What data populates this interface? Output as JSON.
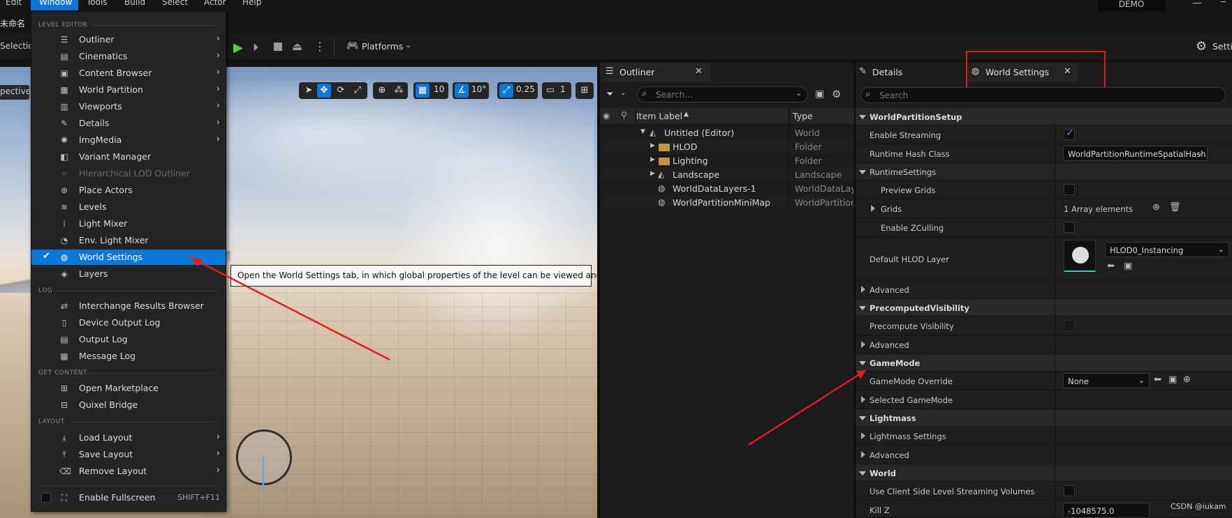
{
  "menubar": {
    "items": [
      "Edit",
      "Window",
      "Tools",
      "Build",
      "Select",
      "Actor",
      "Help"
    ],
    "active": "Window",
    "project_badge": "DEMO"
  },
  "project": {
    "name": "未命名"
  },
  "toolbar": {
    "selection_mode": "Selectio",
    "platforms_label": "Platforms"
  },
  "viewport": {
    "perspective_label": "pective",
    "grid_snap": "10",
    "rotation_snap": "10°",
    "scale_snap": "0.25",
    "camera_speed": "1"
  },
  "window_menu": {
    "sections": {
      "level_editor": "LEVEL EDITOR",
      "log": "LOG",
      "get_content": "GET CONTENT",
      "layout": "LAYOUT"
    },
    "items": [
      {
        "label": "Outliner",
        "icon": "list-icon"
      },
      {
        "label": "Cinematics",
        "icon": "film-icon"
      },
      {
        "label": "Content Browser",
        "icon": "folder-icon"
      },
      {
        "label": "World Partition",
        "icon": "grid-icon"
      },
      {
        "label": "Viewports",
        "icon": "viewport-icon"
      },
      {
        "label": "Details",
        "icon": "details-icon"
      },
      {
        "label": "ImgMedia",
        "icon": "media-icon"
      },
      {
        "label": "Variant Manager",
        "icon": "variant-icon"
      },
      {
        "label": "Hierarchical LOD Outliner",
        "icon": "lod-icon"
      },
      {
        "label": "Place Actors",
        "icon": "place-icon"
      },
      {
        "label": "Levels",
        "icon": "levels-icon"
      },
      {
        "label": "Light Mixer",
        "icon": "light-icon"
      },
      {
        "label": "Env. Light Mixer",
        "icon": "env-light-icon"
      },
      {
        "label": "World Settings",
        "icon": "globe-icon"
      },
      {
        "label": "Layers",
        "icon": "layers-icon"
      },
      {
        "label": "Interchange Results Browser",
        "icon": "interchange-icon"
      },
      {
        "label": "Device Output Log",
        "icon": "device-log-icon"
      },
      {
        "label": "Output Log",
        "icon": "log-icon"
      },
      {
        "label": "Message Log",
        "icon": "message-log-icon"
      },
      {
        "label": "Open Marketplace",
        "icon": "marketplace-icon"
      },
      {
        "label": "Quixel Bridge",
        "icon": "bridge-icon"
      },
      {
        "label": "Load Layout",
        "icon": "load-layout-icon"
      },
      {
        "label": "Save Layout",
        "icon": "save-layout-icon"
      },
      {
        "label": "Remove Layout",
        "icon": "remove-layout-icon"
      },
      {
        "label": "Enable Fullscreen",
        "icon": "fullscreen-icon",
        "shortcut": "SHIFT+F11"
      }
    ]
  },
  "tooltip": {
    "text": "Open the World Settings tab, in which global properties of the level can be viewed and edited."
  },
  "outliner": {
    "tab_label": "Outliner",
    "search_placeholder": "Search...",
    "col_label": "Item Label",
    "col_type": "Type",
    "rows": [
      {
        "label": "Untitled (Editor)",
        "type": "World"
      },
      {
        "label": "HLOD",
        "type": "Folder"
      },
      {
        "label": "Lighting",
        "type": "Folder"
      },
      {
        "label": "Landscape",
        "type": "Landscape"
      },
      {
        "label": "WorldDataLayers-1",
        "type": "WorldDataLay"
      },
      {
        "label": "WorldPartitionMiniMap",
        "type": "WorldPartition"
      }
    ]
  },
  "details": {
    "details_tab": "Details",
    "world_settings_tab": "World Settings",
    "search_placeholder": "Search",
    "categories": {
      "wp_setup": "WorldPartitionSetup",
      "runtime": "RuntimeSettings",
      "advanced1": "Advanced",
      "precomputed": "PrecomputedVisibility",
      "advanced2": "Advanced",
      "gamemode": "GameMode",
      "lightmass": "Lightmass",
      "advanced3": "Advanced",
      "world": "World"
    },
    "props": {
      "enable_streaming": "Enable Streaming",
      "runtime_hash_class": "Runtime Hash Class",
      "runtime_hash_value": "WorldPartitionRuntimeSpatialHash",
      "preview_grids": "Preview Grids",
      "grids": "Grids",
      "grids_value": "1 Array elements",
      "enable_zculling": "Enable ZCulling",
      "default_hlod_layer": "Default HLOD Layer",
      "hlod_value": "HLOD0_Instancing",
      "precompute_visibility": "Precompute Visibility",
      "gamemode_override": "GameMode Override",
      "gamemode_value": "None",
      "selected_gamemode": "Selected GameMode",
      "lightmass_settings": "Lightmass Settings",
      "use_client_side": "Use Client Side Level Streaming Volumes",
      "kill_z": "Kill Z",
      "kill_z_value": "-1048575.0"
    }
  },
  "watermark": "CSDN @iukam",
  "colors": {
    "accent": "#0b78d9",
    "highlight": "#e01e1e"
  }
}
